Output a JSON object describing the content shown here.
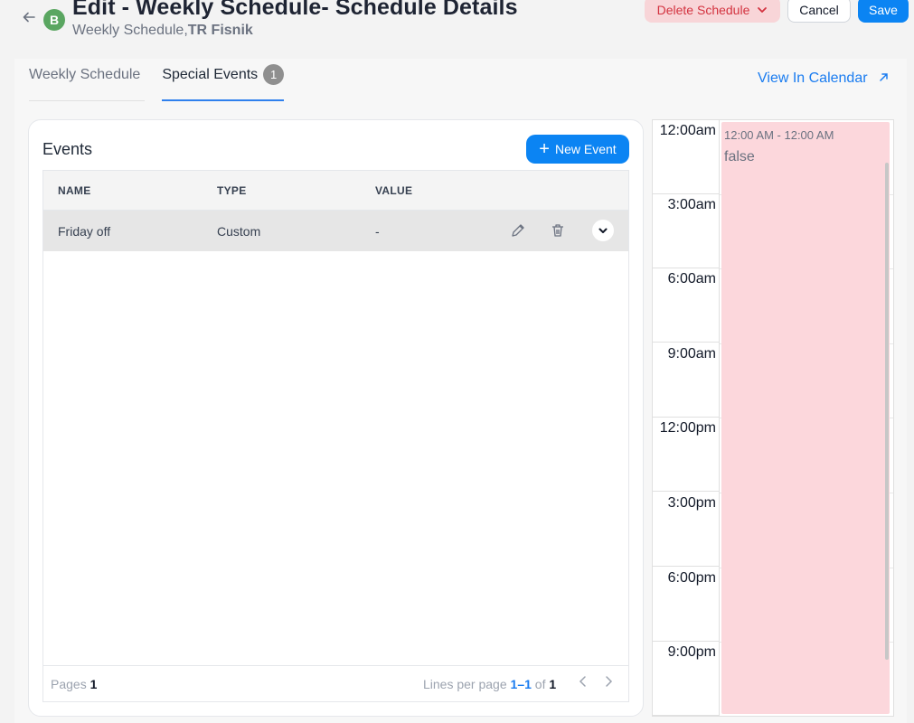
{
  "header": {
    "title": "Edit - Weekly Schedule- Schedule Details",
    "subtitle_prefix": "Weekly Schedule,",
    "subtitle_bold": "TR Fisnik",
    "avatar_letter": "B",
    "back_icon": "arrow-left-icon",
    "delete_label": "Delete Schedule",
    "cancel_label": "Cancel",
    "save_label": "Save"
  },
  "tabs": [
    {
      "label": "Weekly Schedule",
      "active": false
    },
    {
      "label": "Special Events",
      "active": true,
      "badge": "1"
    }
  ],
  "view_calendar_label": "View In Calendar",
  "events": {
    "title": "Events",
    "new_button_label": "New Event",
    "columns": [
      "NAME",
      "TYPE",
      "VALUE"
    ],
    "rows": [
      {
        "name": "Friday off",
        "type": "Custom",
        "value": "-"
      }
    ],
    "footer": {
      "pages_label": "Pages",
      "pages_value": "1",
      "lines_label": "Lines per page",
      "range": "1–1",
      "of_label": "of",
      "total": "1"
    }
  },
  "calendar": {
    "slots": [
      "12:00am",
      "3:00am",
      "6:00am",
      "9:00am",
      "12:00pm",
      "3:00pm",
      "6:00pm",
      "9:00pm"
    ],
    "event": {
      "time": "12:00 AM - 12:00 AM",
      "title": "false",
      "color": "#fcd7dc"
    }
  },
  "colors": {
    "primary": "#0b84f3",
    "danger_bg": "#f8d5d8",
    "danger_text": "#d3323f",
    "avatar": "#5aa661"
  }
}
